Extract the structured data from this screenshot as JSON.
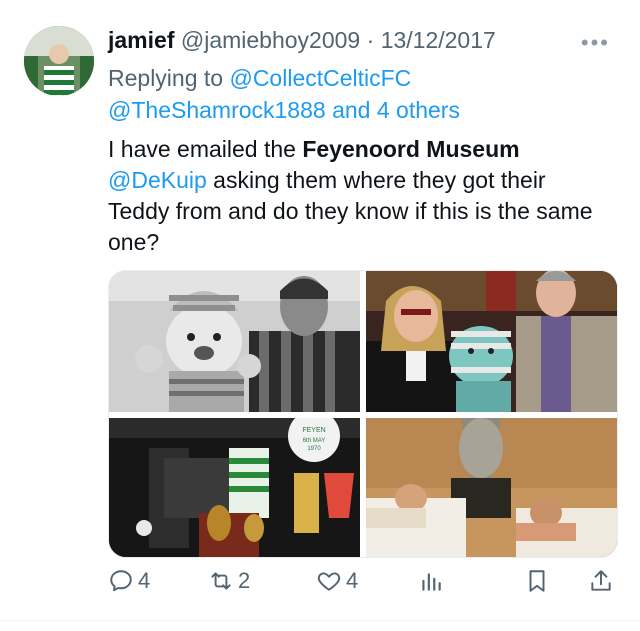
{
  "tweet": {
    "display_name": "jamief",
    "handle": "@jamiebhoy2009",
    "separator": "·",
    "date": "13/12/2017",
    "more_label": "•••",
    "replying_prefix": "Replying to",
    "replying_to_1": "@CollectCelticFC",
    "replying_to_2": "@TheShamrock1888",
    "replying_others": "and 4 others",
    "text_part1": "I have emailed the ",
    "text_bold": "Feyenoord Museum",
    "text_mention": "@DeKuip",
    "text_part2": " asking them where they got their Teddy from and do they know if this is the same one?"
  },
  "photos": {
    "p3_banner": "FEYEN… 6th MAY 1970"
  },
  "actions": {
    "reply_count": "4",
    "retweet_count": "2",
    "like_count": "4"
  },
  "colors": {
    "link": "#1d9bf0",
    "muted": "#536471",
    "text": "#0f1419"
  }
}
